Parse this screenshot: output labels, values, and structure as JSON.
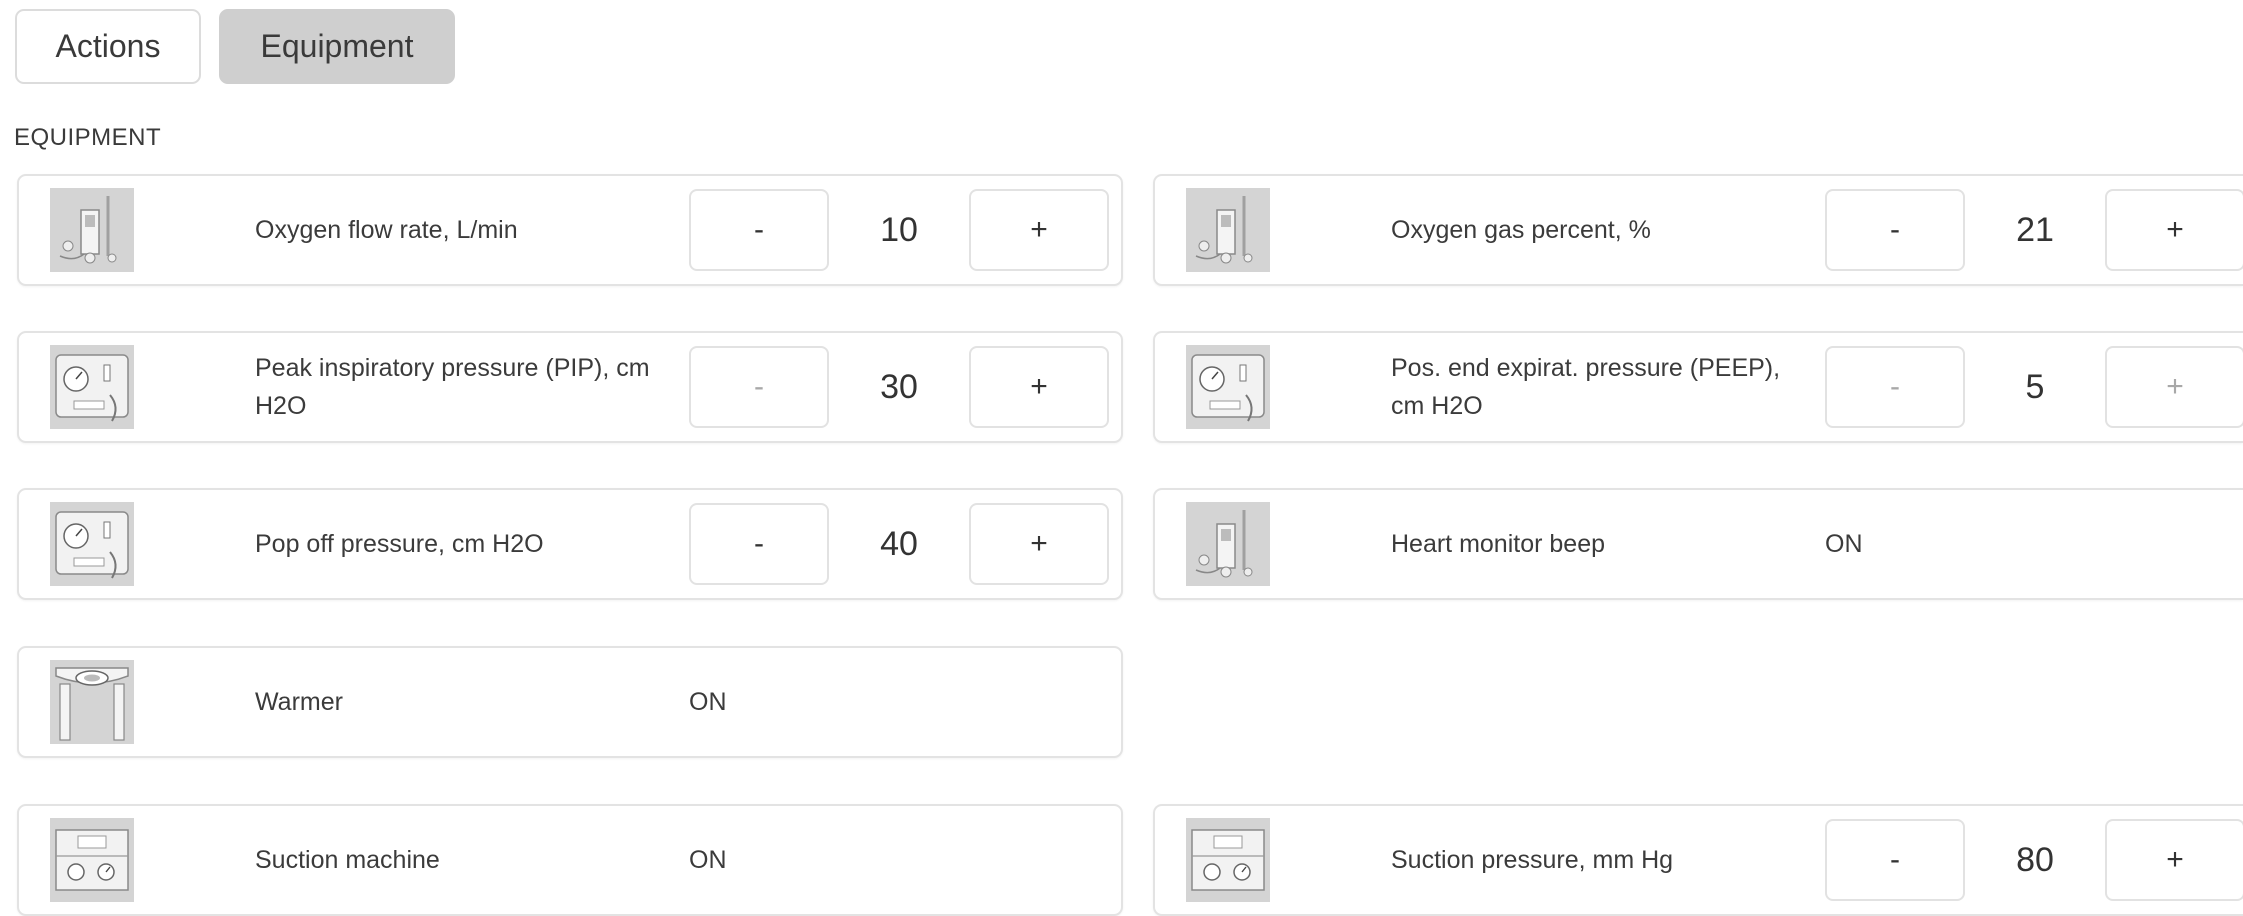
{
  "tabs": [
    {
      "label": "Actions"
    },
    {
      "label": "Equipment"
    }
  ],
  "section_title": "EQUIPMENT",
  "controls": {
    "minus_label": "-",
    "plus_label": "+"
  },
  "items": {
    "oxygen_flow": {
      "label": "Oxygen flow rate, L/min",
      "value": "10",
      "icon": "oxygen-equipment-icon"
    },
    "oxygen_gas": {
      "label": "Oxygen gas percent, %",
      "value": "21",
      "icon": "oxygen-equipment-icon"
    },
    "pip": {
      "label": "Peak inspiratory pressure (PIP), cm H2O",
      "value": "30",
      "icon": "pressure-gauge-icon"
    },
    "peep": {
      "label": "Pos. end expirat. pressure (PEEP), cm H2O",
      "value": "5",
      "icon": "pressure-gauge-icon"
    },
    "pop_off": {
      "label": "Pop off pressure, cm H2O",
      "value": "40",
      "icon": "pressure-gauge-icon"
    },
    "heart_monitor": {
      "label": "Heart monitor beep",
      "state": "ON",
      "icon": "heart-monitor-icon"
    },
    "warmer": {
      "label": "Warmer",
      "state": "ON",
      "icon": "warmer-icon"
    },
    "suction_machine": {
      "label": "Suction machine",
      "state": "ON",
      "icon": "suction-machine-icon"
    },
    "suction_pressure": {
      "label": "Suction pressure, mm Hg",
      "value": "80",
      "icon": "suction-machine-icon"
    }
  }
}
